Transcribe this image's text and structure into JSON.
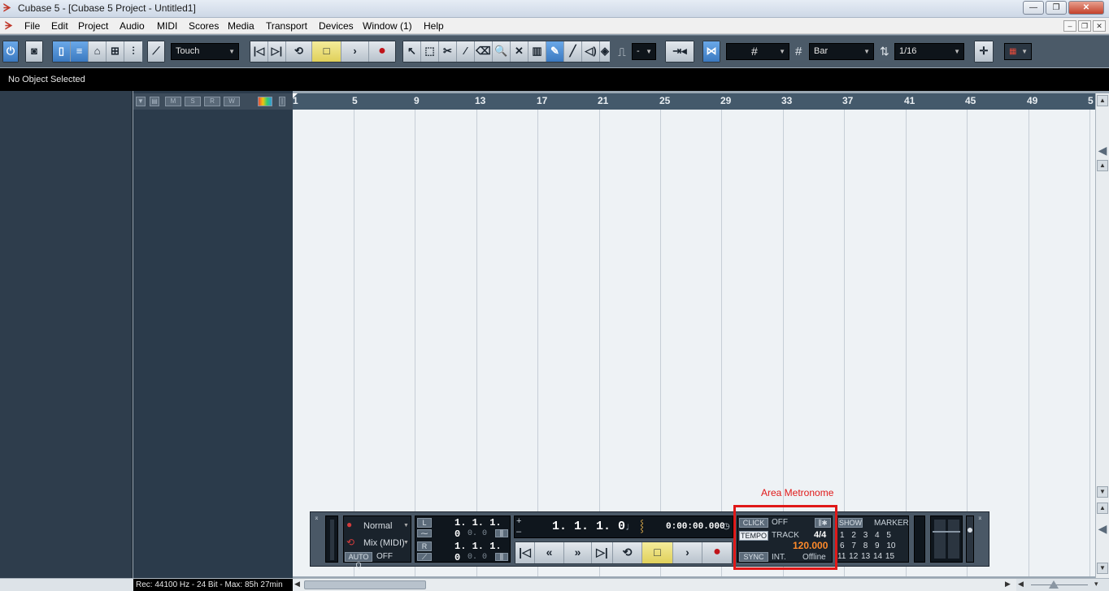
{
  "window": {
    "title": "Cubase 5 - [Cubase 5 Project - Untitled1]",
    "minimize": "—",
    "maximize": "❐",
    "close": "✕"
  },
  "menu": {
    "items": [
      "File",
      "Edit",
      "Project",
      "Audio",
      "MIDI",
      "Scores",
      "Media",
      "Transport",
      "Devices",
      "Window (1)",
      "Help"
    ]
  },
  "toolbar": {
    "automation_mode": "Touch",
    "snap_value": "-",
    "grid_type": "Bar",
    "quantize": "1/16",
    "grid_value": ""
  },
  "info_line": {
    "text": "No Object Selected"
  },
  "ruler": {
    "bars": [
      "1",
      "5",
      "9",
      "13",
      "17",
      "21",
      "25",
      "29",
      "33",
      "37",
      "41",
      "45",
      "49",
      "5"
    ]
  },
  "transport": {
    "record_mode": "Normal",
    "cycle_mode": "Mix (MIDI)",
    "auto_q_label": "AUTO Q",
    "auto_q_value": "OFF",
    "left_locator": "1.  1.  1.    0",
    "left_sub": "0.   0",
    "right_locator": "1.  1.  1.    0",
    "right_sub": "0.   0",
    "position_bars": "1.  1.  1.    0",
    "position_time": "0:00:00.000",
    "click_label": "CLICK",
    "click_value": "OFF",
    "tempo_label": "TEMPO",
    "tempo_mode": "TRACK",
    "signature": "4/4",
    "tempo_value": "120.000",
    "sync_label": "SYNC",
    "sync_mode": "INT.",
    "sync_state": "Offline",
    "show_label": "SHOW",
    "marker_label": "MARKER",
    "markers_row1": [
      "1",
      "2",
      "3",
      "4",
      "5"
    ],
    "markers_row2": [
      "6",
      "7",
      "8",
      "9",
      "10"
    ],
    "markers_row3": [
      "11",
      "12",
      "13",
      "14",
      "15"
    ],
    "L": "L",
    "R": "R"
  },
  "annotation": {
    "label": "Area Metronome",
    "color": "#e01818"
  },
  "status": {
    "rec_info": "Rec: 44100 Hz - 24 Bit - Max: 85h 27min"
  },
  "colors": {
    "toolbar_bg": "#4b5a68",
    "accent_on": "#3b79c0",
    "tempo_orange": "#ff8a2a",
    "record_red": "#c0141a"
  }
}
